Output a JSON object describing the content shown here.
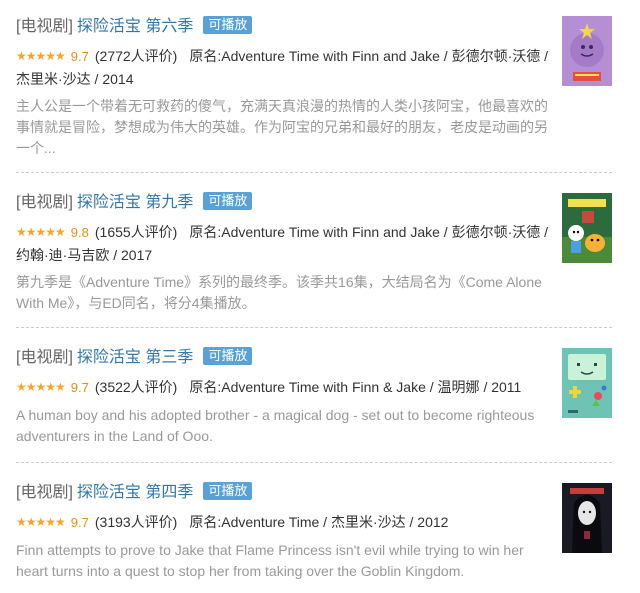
{
  "items": [
    {
      "category": "[电视剧]",
      "title": "探险活宝 第六季",
      "badge": "可播放",
      "stars": "★★★★★",
      "rating": "9.7",
      "count": "(2772人评价)",
      "sub": "原名:Adventure Time with Finn and Jake / 彭德尔顿·沃德 / 杰里米·沙达 / 2014",
      "desc": "主人公是一个带着无可救药的傻气，充满天真浪漫的热情的人类小孩阿宝，他最喜欢的事情就是冒险，梦想成为伟大的英雄。作为阿宝的兄弟和最好的朋友，老皮是动画的另一个...",
      "poster_icon": "lumpy-space-princess-poster"
    },
    {
      "category": "[电视剧]",
      "title": "探险活宝 第九季",
      "badge": "可播放",
      "stars": "★★★★★",
      "rating": "9.8",
      "count": "(1655人评价)",
      "sub": "原名:Adventure Time with Finn and Jake / 彭德尔顿·沃德 / 约翰·迪·马吉欧 / 2017",
      "desc": "第九季是《Adventure Time》系列的最终季。该季共16集，大结局名为《Come Alone With Me》，与ED同名，将分4集播放。",
      "poster_icon": "finn-jake-poster"
    },
    {
      "category": "[电视剧]",
      "title": "探险活宝 第三季",
      "badge": "可播放",
      "stars": "★★★★★",
      "rating": "9.7",
      "count": "(3522人评价)",
      "sub": "原名:Adventure Time with Finn & Jake / 温明娜 / 2011",
      "desc": "A human boy and his adopted brother - a magical dog - set out to become righteous adventurers in the Land of Ooo.",
      "poster_icon": "bmo-poster"
    },
    {
      "category": "[电视剧]",
      "title": "探险活宝 第四季",
      "badge": "可播放",
      "stars": "★★★★★",
      "rating": "9.7",
      "count": "(3193人评价)",
      "sub": "原名:Adventure Time / 杰里米·沙达 / 2012",
      "desc": "Finn attempts to prove to Jake that Flame Princess isn't evil while trying to win her heart turns into a quest to stop her from taking over the Goblin Kingdom.",
      "poster_icon": "marceline-poster"
    }
  ]
}
